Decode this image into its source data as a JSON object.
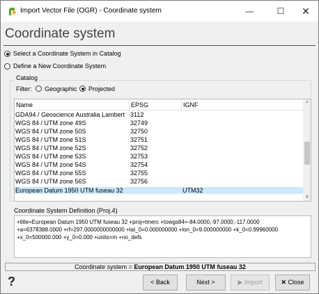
{
  "window": {
    "title": "Import Vector File (OGR) - Coordinate system",
    "minimize": "—",
    "maximize": "☐",
    "close": "✕"
  },
  "page": {
    "title": "Coordinate system"
  },
  "options": {
    "catalog": {
      "label": "Select a Coordinate System in Catalog",
      "selected": true
    },
    "define": {
      "label": "Define a New Coordinate System",
      "selected": false
    }
  },
  "catalog": {
    "group_title": "Catalog",
    "filter_label": "Filter:",
    "filters": [
      {
        "label": "Geographic",
        "selected": false
      },
      {
        "label": "Projected",
        "selected": true
      }
    ],
    "columns": [
      "Name",
      "EPSG",
      "IGNF"
    ],
    "rows": [
      {
        "name": "GDA94 / Geoscience Australia Lambert",
        "epsg": "3112",
        "ignf": ""
      },
      {
        "name": "WGS 84 / UTM zone 49S",
        "epsg": "32749",
        "ignf": ""
      },
      {
        "name": "WGS 84 / UTM zone 50S",
        "epsg": "32750",
        "ignf": ""
      },
      {
        "name": "WGS 84 / UTM zone 51S",
        "epsg": "32751",
        "ignf": ""
      },
      {
        "name": "WGS 84 / UTM zone 52S",
        "epsg": "32752",
        "ignf": ""
      },
      {
        "name": "WGS 84 / UTM zone 53S",
        "epsg": "32753",
        "ignf": ""
      },
      {
        "name": "WGS 84 / UTM zone 54S",
        "epsg": "32754",
        "ignf": ""
      },
      {
        "name": "WGS 84 / UTM zone 55S",
        "epsg": "32755",
        "ignf": ""
      },
      {
        "name": "WGS 84 / UTM zone 56S",
        "epsg": "32756",
        "ignf": ""
      },
      {
        "name": "European Datum 1950 UTM fuseau 32",
        "epsg": "",
        "ignf": "UTM32",
        "selected": true
      }
    ],
    "scroll_up": "^",
    "scroll_down": "v"
  },
  "definition": {
    "label": "Coordinate System Definition (Proj.4)",
    "text": "+title=European Datum 1950 UTM fuseau 32 +proj=tmerc +towgs84=-84.0000,-97.0000,-117.0000\n+a=6378388.0000 +rf=297.0000000000000 +lat_0=0.000000000 +lon_0=9.000000000 +k_0=0.99960000\n+x_0=500000.000 +y_0=0.000 +units=m +no_defs"
  },
  "status": {
    "prefix": "Coordinate system = ",
    "value": "European Datum 1950 UTM fuseau 32"
  },
  "buttons": {
    "help": "?",
    "back": "< Back",
    "next": "Next >",
    "import": "Import",
    "close": "Close"
  },
  "colors": {
    "selection": "#cce8ff",
    "window_bg": "#f0f0f0"
  }
}
